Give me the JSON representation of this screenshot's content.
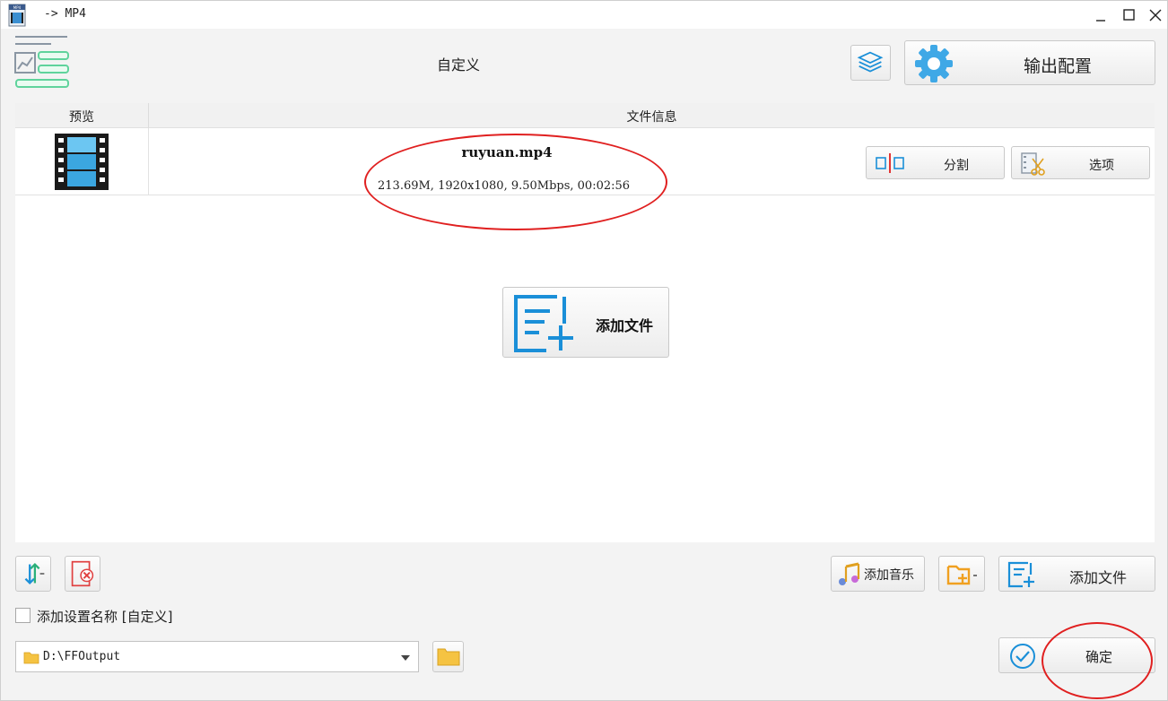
{
  "window": {
    "title": "-> MP4",
    "app_icon": "mp4-file-icon",
    "controls": [
      "minimize-icon",
      "maximize-icon",
      "close-icon"
    ]
  },
  "header": {
    "logo_icon": "settings-list-icon",
    "preset_name": "自定义",
    "layers_icon": "layers-icon",
    "output_config_label": "输出配置",
    "output_config_icon": "gear-icon"
  },
  "table": {
    "columns": [
      "预览",
      "文件信息"
    ],
    "rows": [
      {
        "filename": "ruyuan.mp4",
        "meta": "213.69M, 1920x1080, 9.50Mbps, 00:02:56",
        "split_label": "分割",
        "options_label": "选项"
      }
    ],
    "add_file_label": "添加文件"
  },
  "toolbar": {
    "add_music_label": "添加音乐",
    "add_file_label": "添加文件"
  },
  "options": {
    "add_preset_name_label": "添加设置名称 [自定义]",
    "add_preset_name_checked": false
  },
  "output": {
    "path": "D:\\FFOutput"
  },
  "confirm_label": "确定",
  "colors": {
    "accent_blue": "#1a8fd8",
    "logo_green": "#5fd39c",
    "annotation_red": "#e02020",
    "folder_yellow": "#f5c342"
  }
}
